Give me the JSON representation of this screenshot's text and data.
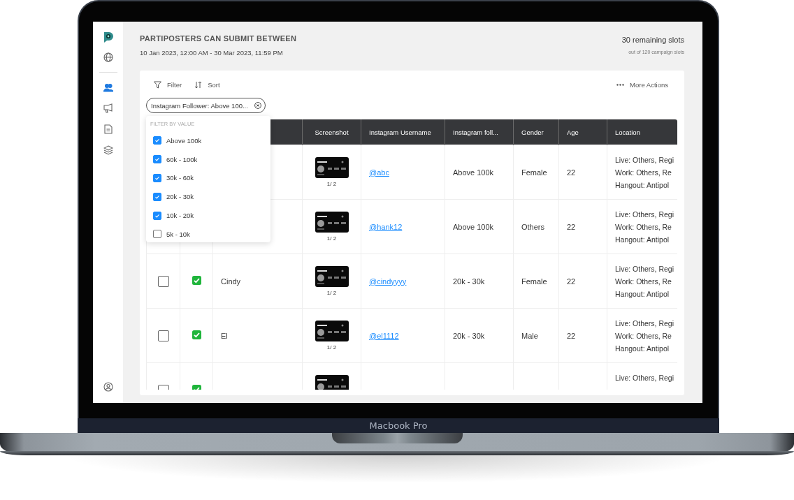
{
  "laptop": {
    "label": "Macbook Pro"
  },
  "sidebar": {
    "top_items": [
      {
        "kind": "globe",
        "selected": false
      }
    ],
    "items": [
      {
        "kind": "people",
        "selected": true
      },
      {
        "kind": "megaphone",
        "selected": false
      },
      {
        "kind": "document",
        "selected": false
      },
      {
        "kind": "layers",
        "selected": false
      }
    ],
    "bottom_items": [
      {
        "kind": "user",
        "selected": false
      }
    ]
  },
  "header": {
    "title": "PARTIPOSTERS CAN SUBMIT BETWEEN",
    "period": "10 Jan 2023, 12:00 AM - 30 Mar 2023, 11:59 PM",
    "slots": "30 remaining slots",
    "slots_note": "out of 120 campaign slots"
  },
  "toolbar": {
    "actions": [
      {
        "kind": "filter",
        "label": "Filter"
      },
      {
        "kind": "sort",
        "label": "Sort"
      }
    ],
    "more_actions": "More Actions"
  },
  "active_filter": {
    "label": "Instagram Follower: Above 100..."
  },
  "filter_menu": {
    "heading": "FILTER BY VALUE",
    "options": [
      {
        "label": "Above 100k",
        "checked": true
      },
      {
        "label": "60k - 100k",
        "checked": true
      },
      {
        "label": "30k - 60k",
        "checked": true
      },
      {
        "label": "20k - 30k",
        "checked": true
      },
      {
        "label": "10k - 20k",
        "checked": true
      },
      {
        "label": "5k - 10k",
        "checked": false
      }
    ]
  },
  "table": {
    "columns": [
      "Screenshot",
      "Instagram Username",
      "Instagram foll...",
      "Gender",
      "Age",
      "Location"
    ],
    "rows": [
      {
        "screenshot_count": "1/ 2",
        "username": "@abc",
        "followers": "Above 100k",
        "gender": "Female",
        "age": "22",
        "location": [
          "Live: Others, Regi",
          "Work: Others, Re",
          "Hangout: Antipol"
        ]
      },
      {
        "screenshot_count": "1/ 2",
        "username": "@hank12",
        "followers": "Above 100k",
        "gender": "Others",
        "age": "22",
        "location": [
          "Live: Others, Regi",
          "Work: Others, Re",
          "Hangout: Antipol"
        ]
      },
      {
        "selected": false,
        "approved": true,
        "name": "Cindy",
        "screenshot_count": "1/ 2",
        "username": "@cindyyyy",
        "followers": "20k - 30k",
        "gender": "Female",
        "age": "22",
        "location": [
          "Live: Others, Regi",
          "Work: Others, Re",
          "Hangout: Antipol"
        ]
      },
      {
        "selected": false,
        "approved": true,
        "name": "El",
        "screenshot_count": "1/ 2",
        "username": "@el1112",
        "followers": "20k - 30k",
        "gender": "Male",
        "age": "22",
        "location": [
          "Live: Others, Regi",
          "Work: Others, Re",
          "Hangout: Antipol"
        ]
      },
      {
        "selected": false,
        "approved": true,
        "location": [
          "Live: Others, Regi"
        ]
      }
    ]
  }
}
